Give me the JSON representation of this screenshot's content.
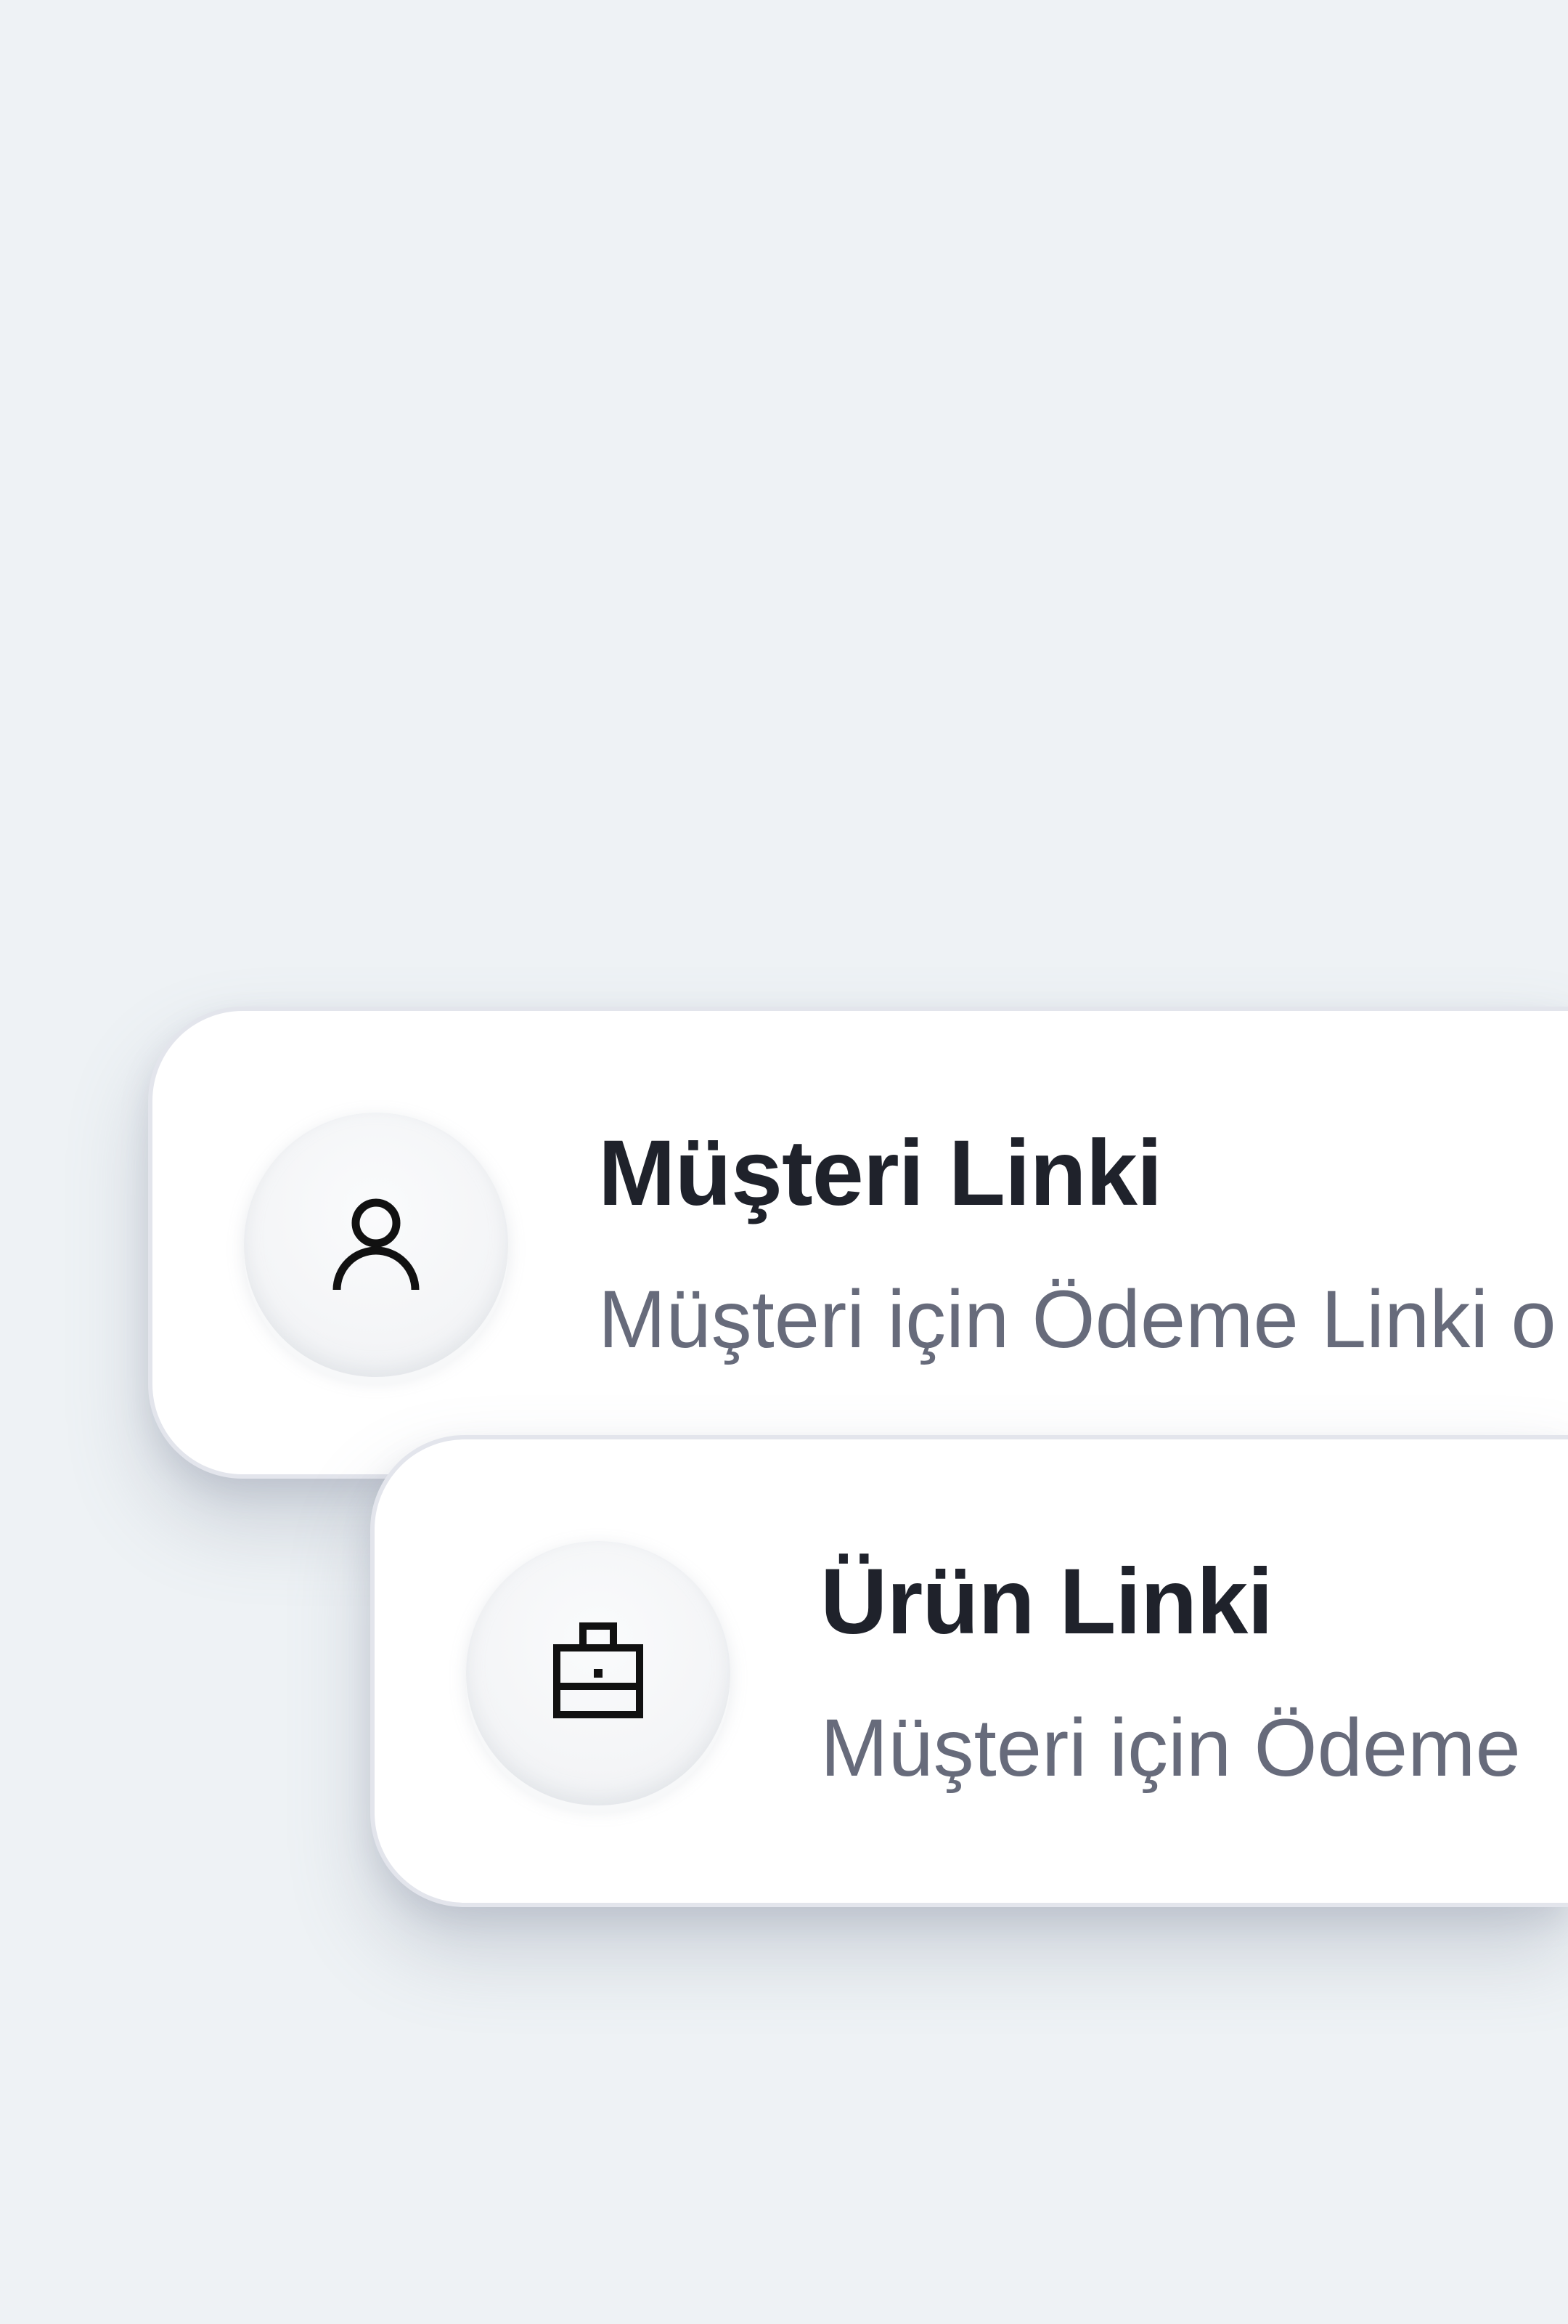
{
  "cards": [
    {
      "title": "Müşteri Linki",
      "subtitle": "Müşteri için Ödeme Linki o",
      "icon": "user-icon"
    },
    {
      "title": "Ürün Linki",
      "subtitle": "Müşteri için Ödeme",
      "icon": "briefcase-icon"
    }
  ],
  "colors": {
    "background": "#eef2f5",
    "card": "#ffffff",
    "title": "#1f222b",
    "subtitle": "#676b7b"
  }
}
